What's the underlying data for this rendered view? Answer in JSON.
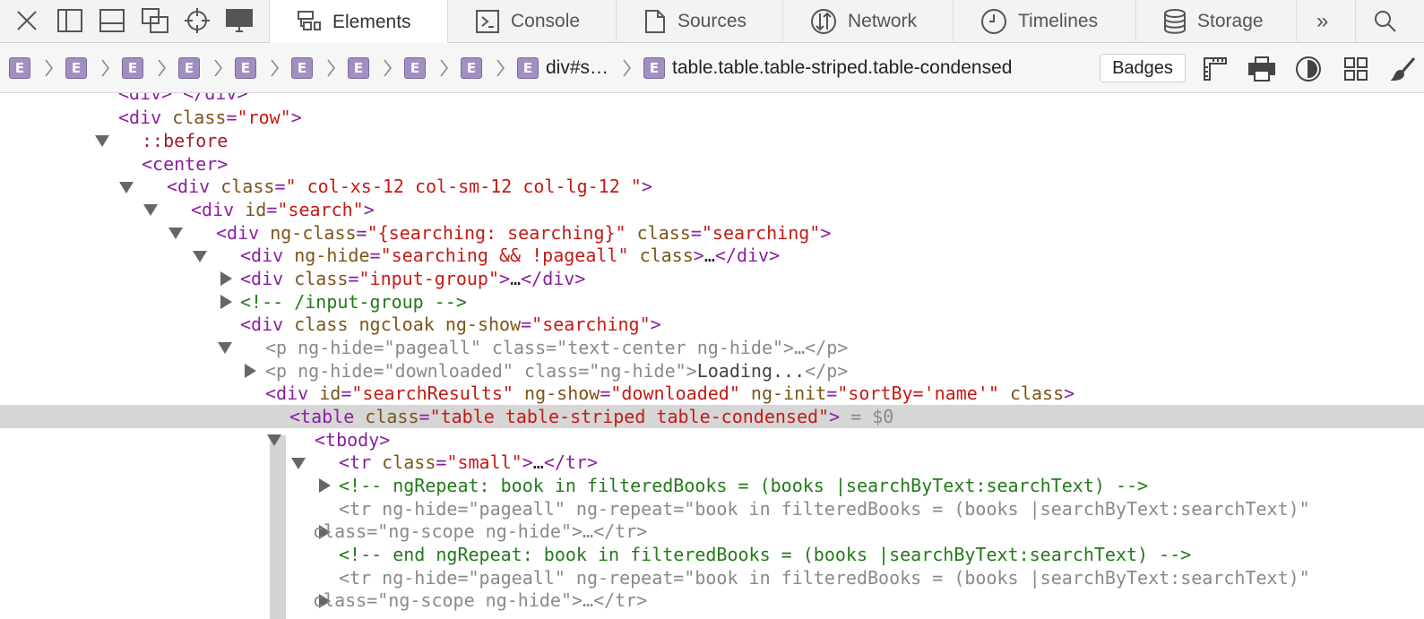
{
  "tabs": [
    {
      "label": "Elements"
    },
    {
      "label": "Console"
    },
    {
      "label": "Sources"
    },
    {
      "label": "Network"
    },
    {
      "label": "Timelines"
    },
    {
      "label": "Storage"
    }
  ],
  "tabbar": {
    "overflow_label": "»"
  },
  "breadcrumb": {
    "badge_letter": "E",
    "div_label": "div#s…",
    "current_label": "table.table.table-striped.table-condensed"
  },
  "toolbar": {
    "badges_label": "Badges"
  },
  "tree": {
    "row0": {
      "text": "<div> </div>"
    },
    "row1": {
      "tag": "<div",
      "attr": "class",
      "eq": "=",
      "val": "\"row\"",
      "close": ">"
    },
    "row2": {
      "text": "::before"
    },
    "row3": {
      "tag": "<center>"
    },
    "row4": {
      "tag": "<div",
      "attr": "class",
      "eq": "=",
      "val": "\" col-xs-12 col-sm-12 col-lg-12 \"",
      "close": ">"
    },
    "row5": {
      "tag": "<div",
      "attr": "id",
      "eq": "=",
      "val": "\"search\"",
      "close": ">"
    },
    "row6": {
      "tag": "<div",
      "attr1": "ng-class",
      "val1": "\"{searching: searching}\"",
      "attr2": "class",
      "val2": "\"searching\"",
      "close": ">"
    },
    "row7": {
      "tag": "<div",
      "attr1": "ng-hide",
      "val1": "\"searching && !pageall\"",
      "attr2": "class",
      "close": ">",
      "ellipsis": "…",
      "endtag": "</div>"
    },
    "row8": {
      "tag": "<div",
      "attr": "class",
      "val": "\"input-group\"",
      "close": ">",
      "ellipsis": "…",
      "endtag": "</div>"
    },
    "row9": {
      "comment": "<!-- /input-group -->"
    },
    "row10": {
      "tag": "<div",
      "attr1": "class",
      "attr2": "ngcloak",
      "attr3": "ng-show",
      "val3": "\"searching\"",
      "close": ">"
    },
    "row11": {
      "tag": "<p",
      "attr1": "ng-hide",
      "val1": "\"pageall\"",
      "attr2": "class",
      "val2": "\"text-center ng-hide\"",
      "close": ">",
      "ellipsis": "…",
      "endtag": "</p>"
    },
    "row12": {
      "tag": "<p",
      "attr1": "ng-hide",
      "val1": "\"downloaded\"",
      "attr2": "class",
      "val2": "\"ng-hide\"",
      "close": ">",
      "text": "Loading...",
      "endtag": "</p>"
    },
    "row13": {
      "tag": "<div",
      "attr1": "id",
      "val1": "\"searchResults\"",
      "attr2": "ng-show",
      "val2": "\"downloaded\"",
      "attr3": "ng-init",
      "val3": "\"sortBy='name'\"",
      "attr4": "class",
      "close": ">"
    },
    "row14": {
      "tag": "<table",
      "attr": "class",
      "val": "\"table table-striped table-condensed\"",
      "close": ">",
      "dollar": " = $0"
    },
    "row15": {
      "tag": "<tbody>"
    },
    "row16": {
      "tag": "<tr",
      "attr": "class",
      "val": "\"small\"",
      "close": ">",
      "ellipsis": "…",
      "endtag": "</tr>"
    },
    "row17": {
      "comment": "<!-- ngRepeat: book in filteredBooks = (books |searchByText:searchText) -->"
    },
    "row18": {
      "text": "<tr ng-hide=\"pageall\" ng-repeat=\"book in filteredBooks = (books |searchByText:searchText)\""
    },
    "row19": {
      "text": "class=\"ng-scope ng-hide\">…</tr>"
    },
    "row20": {
      "comment": "<!-- end ngRepeat: book in filteredBooks = (books |searchByText:searchText) -->"
    },
    "row21": {
      "text": "<tr ng-hide=\"pageall\" ng-repeat=\"book in filteredBooks = (books |searchByText:searchText)\""
    },
    "row22": {
      "text": "class=\"ng-scope ng-hide\">…</tr>"
    }
  },
  "colors": {
    "tag": "#8b1fa0",
    "attr": "#7b5518",
    "value": "#c41a16",
    "comment": "#237a1a",
    "element_badge": "#a28fc1",
    "selected_row": "#d6d6d6"
  }
}
